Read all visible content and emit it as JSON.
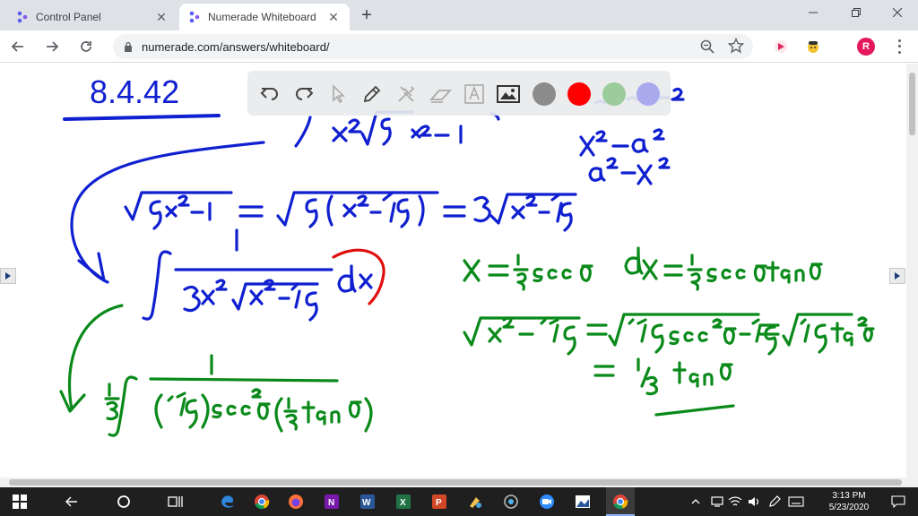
{
  "browser": {
    "tabs": [
      {
        "title": "Control Panel",
        "active": false
      },
      {
        "title": "Numerade Whiteboard",
        "active": true
      }
    ],
    "url": "numerade.com/answers/whiteboard/",
    "profile_initial": "R",
    "colors": {
      "profile": "#e5185d",
      "tab_strip": "#dee1e6"
    }
  },
  "whiteboard": {
    "heading": "8.4.42",
    "palette": {
      "tools": [
        "undo-icon",
        "redo-icon",
        "pointer-icon",
        "pen-icon",
        "tools-icon",
        "eraser-icon",
        "text-icon",
        "image-icon"
      ],
      "swatches": [
        "#8c8c8c",
        "#ff0000",
        "#9ccc9c",
        "#a9a9ee"
      ]
    },
    "ink": {
      "blue": "#1020d0",
      "green": "#0a8a1a",
      "red": "#e01010"
    }
  },
  "taskbar": {
    "time": "3:13 PM",
    "date": "5/23/2020"
  }
}
